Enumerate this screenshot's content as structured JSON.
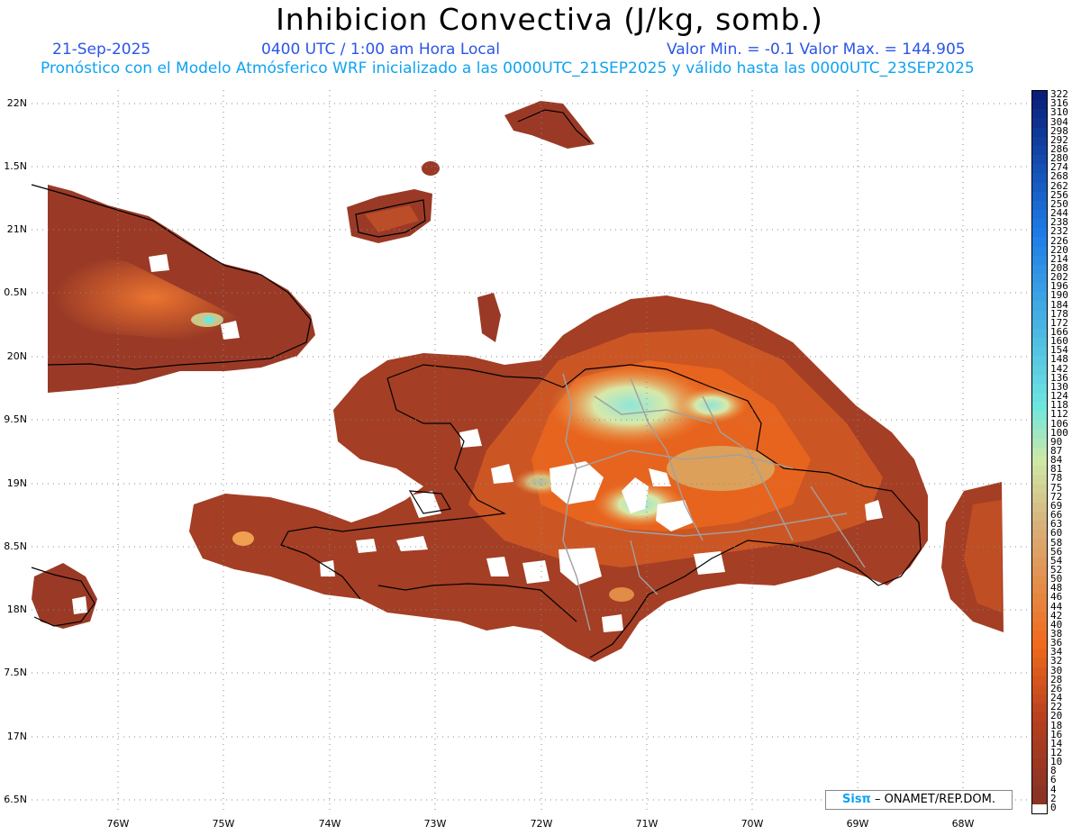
{
  "header": {
    "title": "Inhibicion Convectiva (J/kg, somb.)",
    "date": "21-Sep-2025",
    "time": "0400 UTC / 1:00 am Hora Local",
    "minmax": "Valor Min. = -0.1  Valor Max. = 144.905",
    "info": "Pronóstico con el Modelo Atmósferico WRF inicializado a las 0000UTC_21SEP2025 y válido hasta las  0000UTC_23SEP2025"
  },
  "lat_labels": [
    "22N",
    "1.5N",
    "21N",
    "0.5N",
    "20N",
    "9.5N",
    "19N",
    "8.5N",
    "18N",
    "7.5N",
    "17N",
    "6.5N"
  ],
  "lon_labels": [
    "76W",
    "75W",
    "74W",
    "73W",
    "72W",
    "71W",
    "70W",
    "69W",
    "68W"
  ],
  "colorbar": {
    "labels": [
      "322",
      "316",
      "310",
      "304",
      "298",
      "292",
      "286",
      "280",
      "274",
      "268",
      "262",
      "256",
      "250",
      "244",
      "238",
      "232",
      "226",
      "220",
      "214",
      "208",
      "202",
      "196",
      "190",
      "184",
      "178",
      "172",
      "166",
      "160",
      "154",
      "148",
      "142",
      "136",
      "130",
      "124",
      "118",
      "112",
      "106",
      "100",
      "90",
      "87",
      "84",
      "81",
      "78",
      "75",
      "72",
      "69",
      "66",
      "63",
      "60",
      "58",
      "56",
      "54",
      "52",
      "50",
      "48",
      "46",
      "44",
      "42",
      "40",
      "38",
      "36",
      "34",
      "32",
      "30",
      "28",
      "26",
      "24",
      "22",
      "20",
      "18",
      "16",
      "14",
      "12",
      "10",
      "8",
      "6",
      "4",
      "2",
      "0"
    ],
    "colors": {
      "high": "#0a1f7a",
      "mid_blue": "#1e7be6",
      "cyan": "#6ee6e0",
      "pale_green": "#cfe8a6",
      "tan": "#d8b07a",
      "orange": "#f06a1c",
      "rust": "#b8401e",
      "dark_brown": "#8b3325",
      "zero": "#ffffff"
    }
  },
  "credit": {
    "logo": "Sisπ",
    "text": " – ONAMET/REP.DOM."
  }
}
